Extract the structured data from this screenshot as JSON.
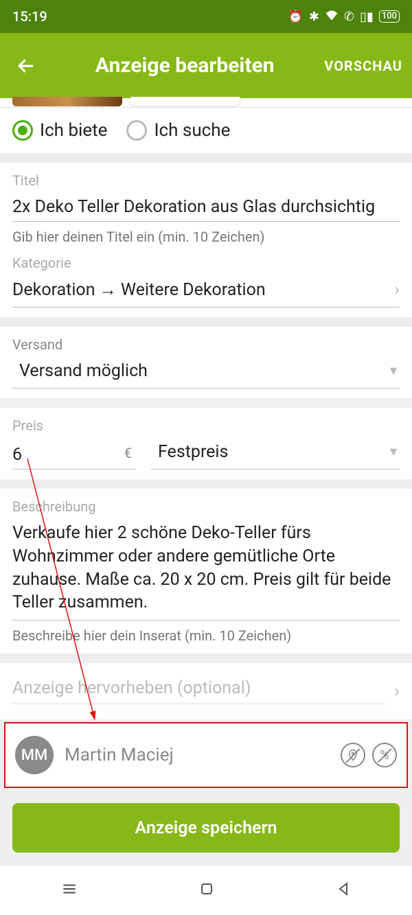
{
  "status": {
    "time": "15:19",
    "battery": "100"
  },
  "appbar": {
    "title": "Anzeige bearbeiten",
    "preview": "VORSCHAU"
  },
  "radios": {
    "offer": "Ich biete",
    "search": "Ich suche"
  },
  "title_field": {
    "label": "Titel",
    "value": "2x Deko Teller Dekoration aus Glas durchsichtig",
    "helper": "Gib hier deinen Titel ein (min. 10 Zeichen)"
  },
  "category": {
    "label": "Kategorie",
    "value": "Dekoration → Weitere Dekoration"
  },
  "shipping": {
    "label": "Versand",
    "value": "Versand möglich"
  },
  "price": {
    "label": "Preis",
    "value": "6",
    "currency": "€",
    "type": "Festpreis"
  },
  "description": {
    "label": "Beschreibung",
    "value": "Verkaufe hier 2 schöne Deko-Teller fürs Wohnzimmer oder andere gemütliche Orte zuhause. Maße ca. 20 x 20 cm. Preis gilt für beide Teller zusammen.",
    "helper": "Beschreibe hier dein Inserat (min. 10 Zeichen)"
  },
  "highlight": {
    "text": "Anzeige hervorheben (optional)"
  },
  "user": {
    "initials": "MM",
    "name": "Martin Maciej"
  },
  "save": {
    "label": "Anzeige speichern"
  }
}
